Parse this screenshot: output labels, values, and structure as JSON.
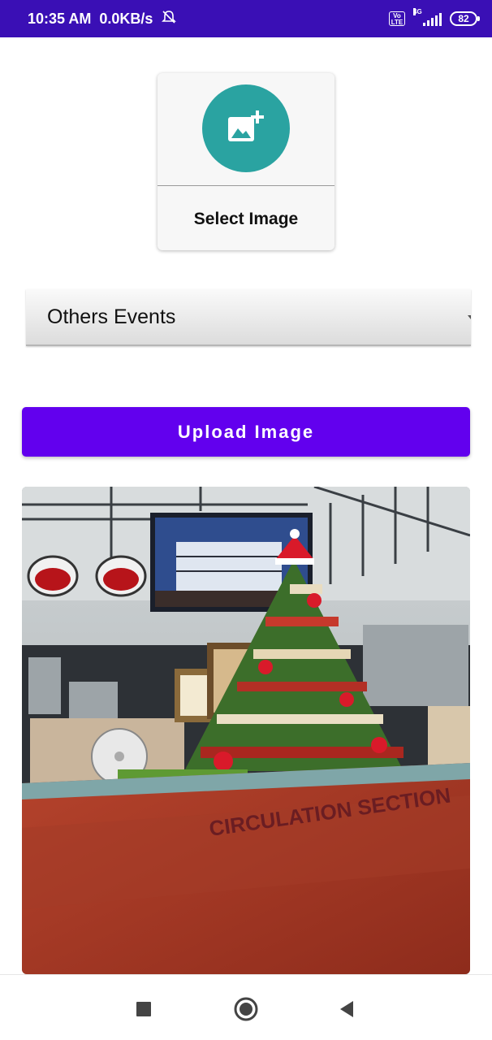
{
  "status_bar": {
    "time": "10:35 AM",
    "speed": "0.0KB/s",
    "volte": "Vo LTE",
    "network": "4G",
    "battery": "82",
    "icons": [
      "mute-icon",
      "volte-icon",
      "signal-icon",
      "battery-icon"
    ]
  },
  "select_image": {
    "label": "Select Image",
    "icon": "add-photo-icon"
  },
  "category_spinner": {
    "selected": "Others Events"
  },
  "upload_button": {
    "label": "Upload Image"
  },
  "preview": {
    "sign_text": "CIRCULATION SECTION",
    "description_icon": "preview-image"
  },
  "nav_bar": {
    "icons": [
      "recents-square-icon",
      "home-circle-icon",
      "back-triangle-icon"
    ]
  },
  "colors": {
    "status_bar": "#3a0fb5",
    "accent": "#6200ee",
    "select_circle": "#2aa3a1"
  }
}
